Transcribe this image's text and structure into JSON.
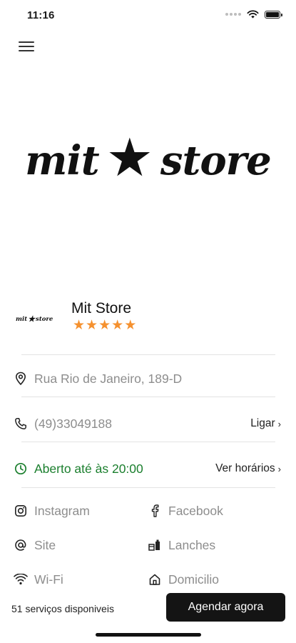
{
  "status_bar": {
    "time": "11:16"
  },
  "hero": {
    "logo_left": "mit",
    "logo_right": "store"
  },
  "store": {
    "name": "Mit Store",
    "mini_logo_left": "mit",
    "mini_logo_right": "store",
    "rating": 5,
    "rating_max": 5,
    "rating_color": "#f5912f"
  },
  "address": {
    "text": "Rua Rio de Janeiro, 189-D"
  },
  "phone": {
    "text": "(49)33049188",
    "action": "Ligar"
  },
  "hours": {
    "text": "Aberto até às 20:00",
    "action": "Ver horários",
    "color": "#1b7f2e"
  },
  "links": [
    {
      "label": "Instagram",
      "icon": "instagram-icon"
    },
    {
      "label": "Facebook",
      "icon": "facebook-icon"
    },
    {
      "label": "Site",
      "icon": "at-icon"
    },
    {
      "label": "Lanches",
      "icon": "snacks-icon"
    },
    {
      "label": "Wi-Fi",
      "icon": "wifi-icon"
    },
    {
      "label": "Domicilio",
      "icon": "home-icon"
    }
  ],
  "bottom": {
    "services": "51 serviços disponiveis",
    "cta": "Agendar agora"
  }
}
